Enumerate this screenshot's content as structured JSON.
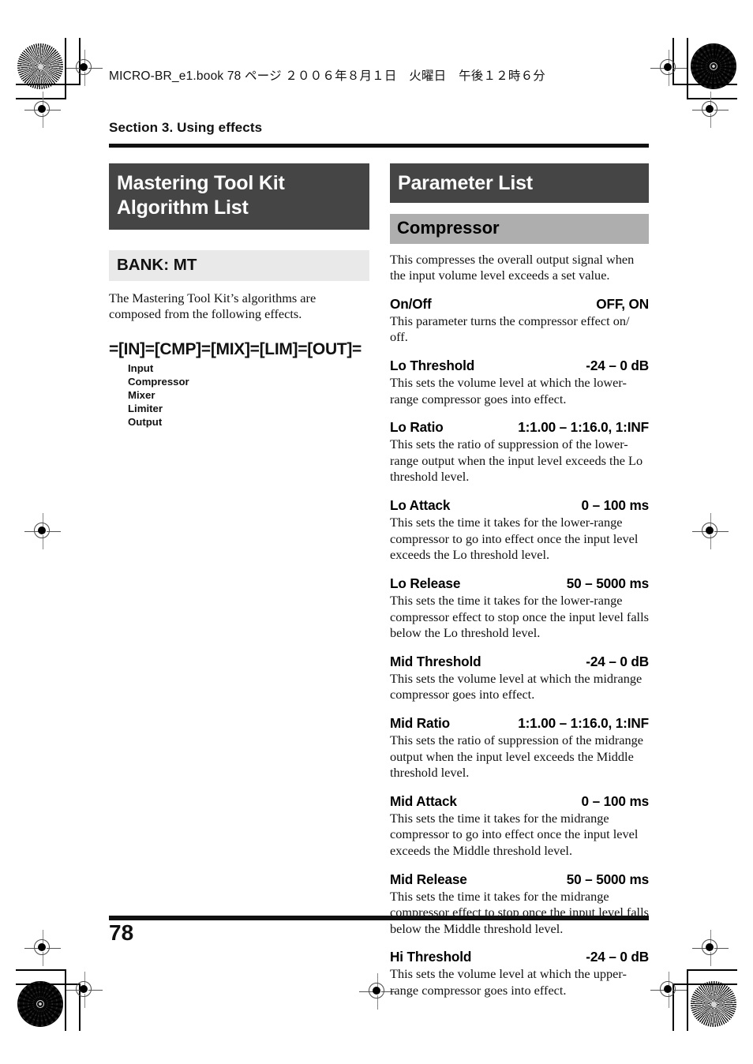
{
  "print_marks": {
    "header_line": "MICRO-BR_e1.book 78 ページ ２００６年８月１日　火曜日　午後１２時６分"
  },
  "page": {
    "section_label": "Section 3. Using effects",
    "page_number": "78"
  },
  "left_column": {
    "title": "Mastering Tool Kit Algorithm List",
    "bank_bar": "BANK: MT",
    "intro": "The Mastering Tool Kit’s algorithms are composed from the following effects.",
    "algorithm_chain": "=[IN]=[CMP]=[MIX]=[LIM]=[OUT]=",
    "effects": [
      "Input",
      "Compressor",
      "Mixer",
      "Limiter",
      "Output"
    ]
  },
  "right_column": {
    "title": "Parameter List",
    "subsection": "Compressor",
    "intro": "This compresses the overall output signal when the input volume level exceeds a set value.",
    "parameters": [
      {
        "name": "On/Off",
        "range": "OFF, ON",
        "description": "This parameter turns the compressor effect on/ off."
      },
      {
        "name": "Lo Threshold",
        "range": "-24 – 0 dB",
        "description": "This sets the volume level at which the lower-range compressor goes into effect."
      },
      {
        "name": "Lo Ratio",
        "range": "1:1.00 – 1:16.0, 1:INF",
        "description": "This sets the ratio of suppression of the lower-range output when the input level exceeds the Lo threshold level."
      },
      {
        "name": "Lo Attack",
        "range": "0 – 100 ms",
        "description": "This sets the time it takes for the lower-range compressor to go into effect once the input level exceeds the Lo threshold level."
      },
      {
        "name": "Lo Release",
        "range": "50 – 5000 ms",
        "description": "This sets the time it takes for the lower-range compressor effect to stop once the input level falls below the Lo threshold level."
      },
      {
        "name": "Mid Threshold",
        "range": "-24 – 0 dB",
        "description": "This sets the volume level at which the midrange compressor goes into effect."
      },
      {
        "name": "Mid Ratio",
        "range": "1:1.00 – 1:16.0, 1:INF",
        "description": "This sets the ratio of suppression of the midrange output when the input level exceeds the Middle threshold level."
      },
      {
        "name": "Mid Attack",
        "range": "0 – 100 ms",
        "description": "This sets the time it takes for the midrange compressor to go into effect once the input level exceeds the Middle threshold level."
      },
      {
        "name": "Mid Release",
        "range": "50 – 5000 ms",
        "description": "This sets the time it takes for the midrange compressor effect to stop once the input level falls below the Middle threshold level."
      },
      {
        "name": "Hi Threshold",
        "range": "-24 – 0 dB",
        "description": "This sets the volume level at which the upper-range compressor goes into effect."
      }
    ]
  },
  "colors": {
    "title_block": "#454545",
    "bank_bar": "#e9e9e9",
    "subsection_bar": "#aeaeae",
    "rule": "#111111"
  }
}
